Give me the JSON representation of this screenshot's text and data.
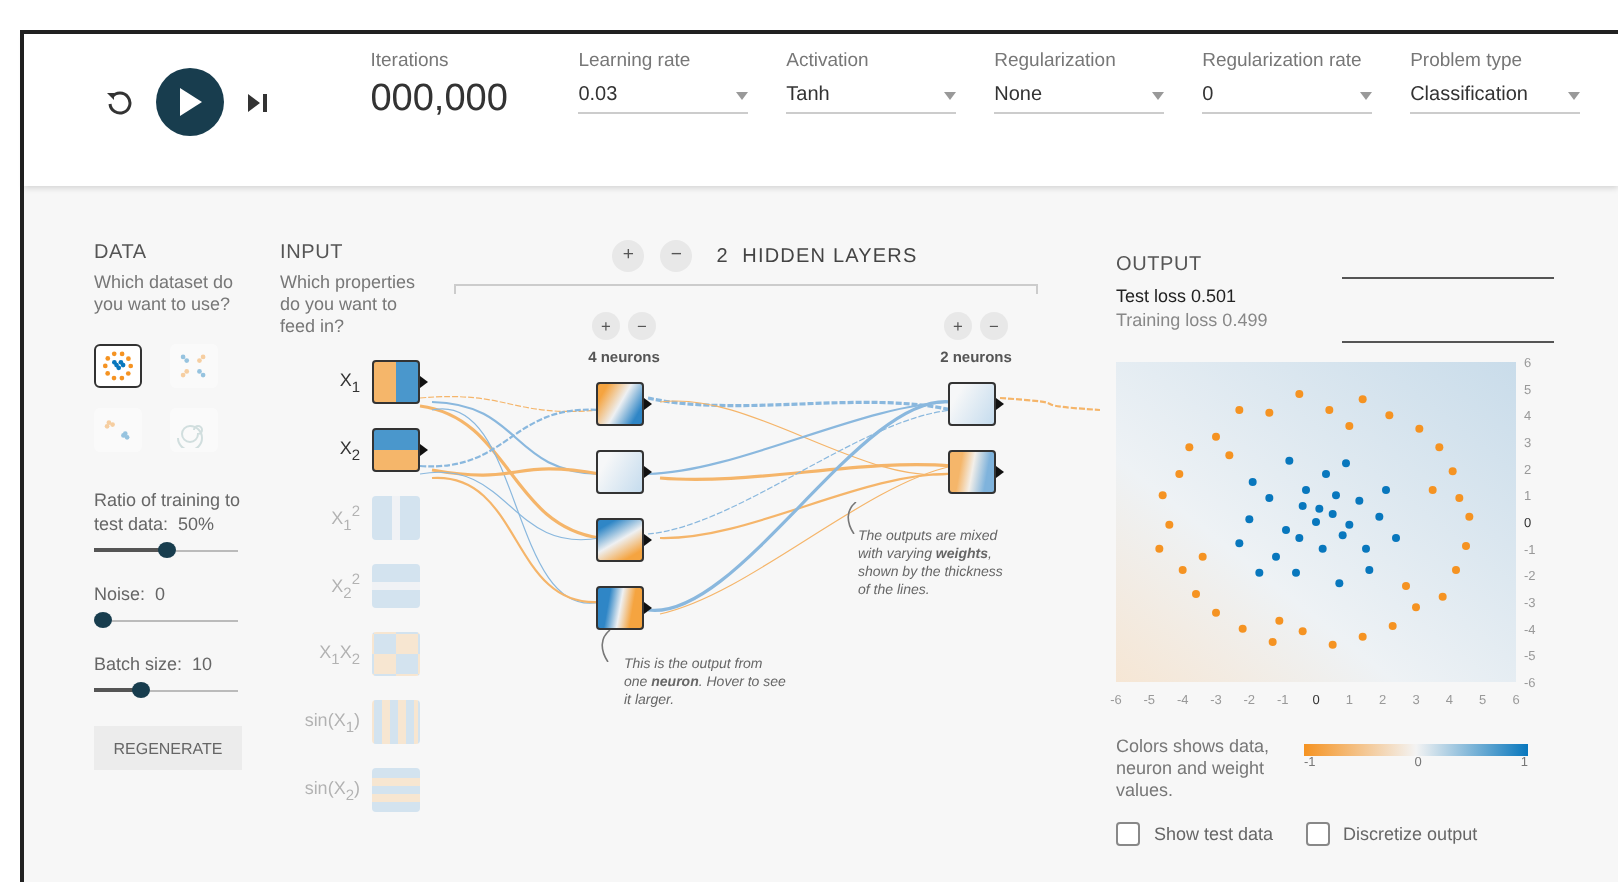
{
  "header": {
    "iterations": {
      "label": "Iterations",
      "value": "000,000"
    },
    "dropdowns": [
      {
        "label": "Learning rate",
        "value": "0.03"
      },
      {
        "label": "Activation",
        "value": "Tanh"
      },
      {
        "label": "Regularization",
        "value": "None"
      },
      {
        "label": "Regularization rate",
        "value": "0"
      },
      {
        "label": "Problem type",
        "value": "Classification"
      }
    ]
  },
  "data": {
    "title": "DATA",
    "prompt": "Which dataset do you want to use?",
    "datasets": [
      {
        "kind": "circle",
        "selected": true
      },
      {
        "kind": "xor",
        "selected": false
      },
      {
        "kind": "gaussian",
        "selected": false
      },
      {
        "kind": "spiral",
        "selected": false
      }
    ],
    "sliders": [
      {
        "label": "Ratio of training to test data:",
        "value": "50%",
        "level": 0.5
      },
      {
        "label": "Noise:",
        "value": "0",
        "level": 0
      },
      {
        "label": "Batch size:",
        "value": "10",
        "level": 0.3
      }
    ],
    "button": "REGENERATE"
  },
  "input": {
    "title": "INPUT",
    "prompt": "Which properties do you want to feed in?",
    "features": [
      {
        "label": "X$_{1}$",
        "kind": "x1",
        "selected": true
      },
      {
        "label": "X$_{2}$",
        "kind": "x2",
        "selected": true
      },
      {
        "label": "X$_{1}$$^{2}$",
        "kind": "x1sq",
        "selected": false
      },
      {
        "label": "X$_{2}$$^{2}$",
        "kind": "x2sq",
        "selected": false
      },
      {
        "label": "X$_{1}$X$_{2}$",
        "kind": "x1x2",
        "selected": false
      },
      {
        "label": "sin(X$_{1}$)",
        "kind": "sinx1",
        "selected": false
      },
      {
        "label": "sin(X$_{2}$)",
        "kind": "sinx2",
        "selected": false
      }
    ]
  },
  "hidden": {
    "add": "+",
    "remove": "−",
    "count": "2",
    "title": "HIDDEN LAYERS",
    "layers": [
      {
        "add": "+",
        "remove": "−",
        "label": "4 neurons",
        "neurons": [
          {
            "kind": "diagonal"
          },
          {
            "kind": "faint"
          },
          {
            "kind": "inverse"
          },
          {
            "kind": "steep"
          }
        ]
      },
      {
        "add": "+",
        "remove": "−",
        "label": "2 neurons",
        "neurons": [
          {
            "kind": "faint"
          },
          {
            "kind": "split"
          }
        ]
      }
    ],
    "notes": [
      "This is the output from one **neuron**. Hover to see it larger.",
      "The outputs are mixed with varying **weights**, shown by the thickness of the lines."
    ]
  },
  "output": {
    "title": "OUTPUT",
    "test_loss": "Test loss 0.501",
    "training_loss": "Training loss 0.499",
    "chart_data": {
      "type": "scatter",
      "xlim": [
        -6,
        6
      ],
      "ylim": [
        -6,
        6
      ],
      "xticks": [
        {
          "value": -6,
          "label": "-6"
        },
        {
          "value": -5,
          "label": "-5"
        },
        {
          "value": -4,
          "label": "-4"
        },
        {
          "value": -3,
          "label": "-3"
        },
        {
          "value": -2,
          "label": "-2"
        },
        {
          "value": -1,
          "label": "-1"
        },
        {
          "value": 0,
          "label": "0"
        },
        {
          "value": 1,
          "label": "1"
        },
        {
          "value": 2,
          "label": "2"
        },
        {
          "value": 3,
          "label": "3"
        },
        {
          "value": 4,
          "label": "4"
        },
        {
          "value": 5,
          "label": "5"
        },
        {
          "value": 6,
          "label": "6"
        }
      ],
      "yticks": [
        {
          "value": -6,
          "label": "-6"
        },
        {
          "value": -5,
          "label": "-5"
        },
        {
          "value": -4,
          "label": "-4"
        },
        {
          "value": -3,
          "label": "-3"
        },
        {
          "value": -2,
          "label": "-2"
        },
        {
          "value": -1,
          "label": "-1"
        },
        {
          "value": 0,
          "label": "0"
        },
        {
          "value": 1,
          "label": "1"
        },
        {
          "value": 2,
          "label": "2"
        },
        {
          "value": 3,
          "label": "3"
        },
        {
          "value": 4,
          "label": "4"
        },
        {
          "value": 5,
          "label": "5"
        },
        {
          "value": 6,
          "label": "6"
        }
      ],
      "series": [
        {
          "color": "#f59322",
          "x": [
            4.6,
            4.3,
            4.1,
            3.7,
            3.1,
            2.2,
            1.4,
            0.4,
            -0.5,
            -1.4,
            -2.3,
            -3.0,
            -3.8,
            -4.1,
            -4.6,
            -4.4,
            -4.7,
            -4.0,
            -3.6,
            -3.0,
            -2.2,
            -1.3,
            -0.4,
            0.5,
            1.4,
            2.3,
            3.0,
            3.8,
            4.2,
            4.5,
            3.5,
            -3.4,
            1.0,
            -1.1,
            2.7,
            -2.6
          ],
          "values": [
            0.2,
            0.9,
            1.9,
            2.8,
            3.5,
            4.0,
            4.6,
            4.2,
            4.8,
            4.1,
            4.2,
            3.2,
            2.8,
            1.8,
            1.0,
            -0.1,
            -1.0,
            -1.8,
            -2.7,
            -3.4,
            -4.0,
            -4.5,
            -4.1,
            -4.6,
            -4.3,
            -3.9,
            -3.2,
            -2.8,
            -1.8,
            -0.9,
            1.2,
            -1.3,
            3.6,
            -3.7,
            -2.4,
            2.5
          ]
        },
        {
          "color": "#0877bd",
          "x": [
            0,
            0.5,
            -0.4,
            0.8,
            -0.9,
            0.2,
            -0.3,
            1.3,
            -1.4,
            1.5,
            -1.2,
            0.3,
            -0.6,
            1.9,
            -2.0,
            2.1,
            -1.9,
            1.6,
            -1.7,
            0.9,
            -0.8,
            0.7,
            -2.3,
            2.4,
            0.1,
            -0.5,
            0.6,
            1.0
          ],
          "values": [
            0,
            0.3,
            0.6,
            -0.5,
            -0.3,
            -1.0,
            1.2,
            0.8,
            0.9,
            -1.0,
            -1.3,
            1.8,
            -1.9,
            0.2,
            0.1,
            1.2,
            1.5,
            -1.8,
            -1.9,
            2.2,
            2.3,
            -2.3,
            -0.8,
            -0.6,
            0.5,
            -0.6,
            1.0,
            -0.1
          ]
        }
      ]
    },
    "legend": {
      "text": "Colors shows data, neuron and weight values.",
      "ticks": [
        "-1",
        "0",
        "1"
      ]
    },
    "options": [
      {
        "label": "Show test data",
        "checked": false
      },
      {
        "label": "Discretize output",
        "checked": false
      }
    ]
  }
}
